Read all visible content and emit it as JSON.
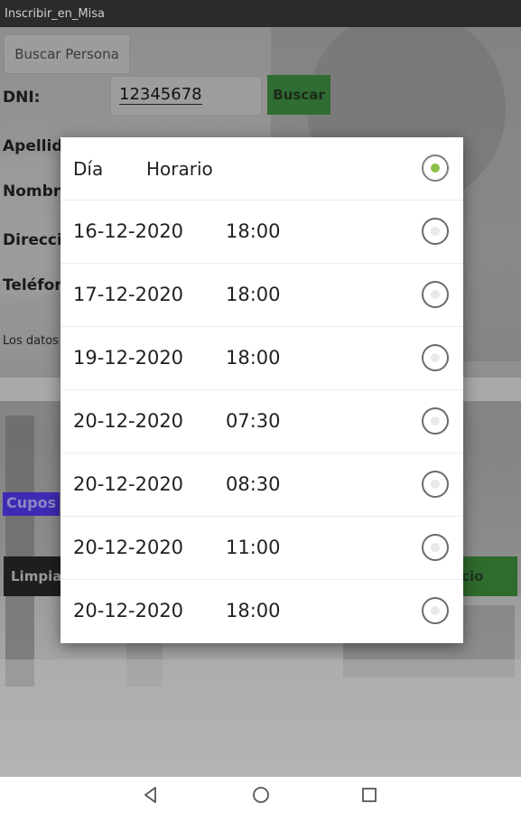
{
  "app": {
    "title": "Inscribir_en_Misa"
  },
  "form": {
    "buscar_persona_label": "Buscar Persona",
    "dni_label": "DNI:",
    "dni_value": "12345678",
    "buscar_label": "Buscar",
    "apellido_label": "Apellido",
    "nombre_label": "Nombre",
    "direccion_label": "Direcci",
    "telefono_label": "Teléfon",
    "datos_text": "Los datos",
    "cupos_label": "Cupos",
    "limpiar_label": "Limpia",
    "inicio_label": "icio"
  },
  "dialog": {
    "header": {
      "dia": "Día",
      "horario": "Horario"
    },
    "header_selected": true,
    "rows": [
      {
        "dia": "16-12-2020",
        "horario": "18:00",
        "selected": false
      },
      {
        "dia": "17-12-2020",
        "horario": "18:00",
        "selected": false
      },
      {
        "dia": "19-12-2020",
        "horario": "18:00",
        "selected": false
      },
      {
        "dia": "20-12-2020",
        "horario": "07:30",
        "selected": false
      },
      {
        "dia": "20-12-2020",
        "horario": "08:30",
        "selected": false
      },
      {
        "dia": "20-12-2020",
        "horario": "11:00",
        "selected": false
      },
      {
        "dia": "20-12-2020",
        "horario": "18:00",
        "selected": false
      }
    ]
  },
  "colors": {
    "accent_radio": "#8bc34a",
    "buscar_button": "#2f6d32",
    "cupos_bg": "#3e2bb4"
  },
  "navbar": {
    "icons": [
      "back-icon",
      "home-icon",
      "recents-icon"
    ]
  }
}
